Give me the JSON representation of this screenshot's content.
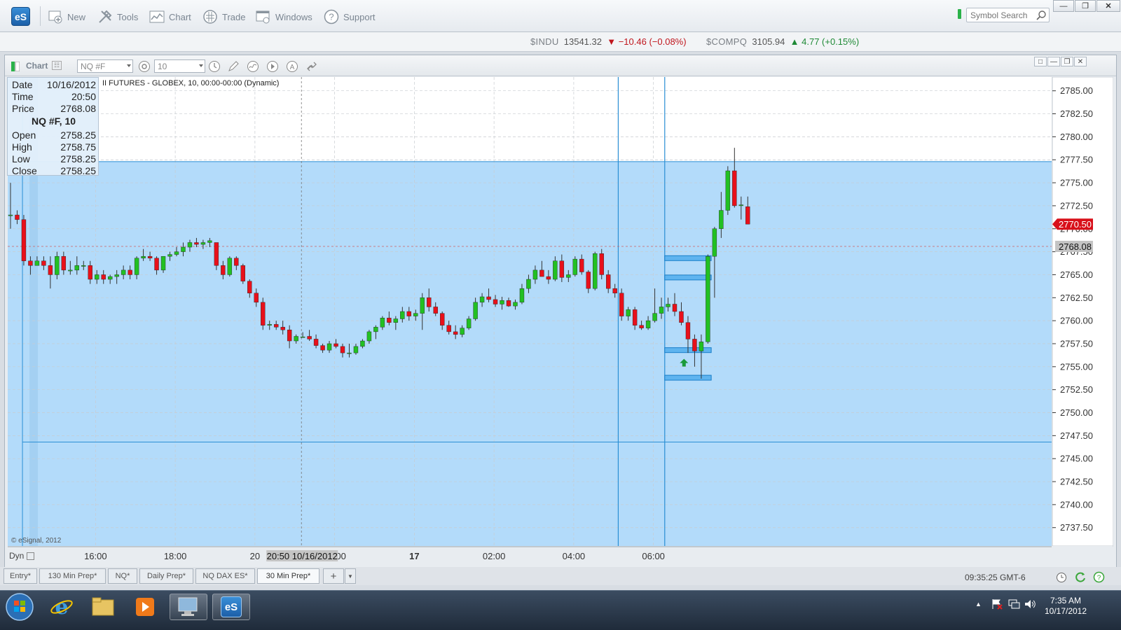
{
  "app": {
    "logo": "eS",
    "toolbar": [
      {
        "label": "New",
        "icon": "new-icon"
      },
      {
        "label": "Tools",
        "icon": "tools-icon"
      },
      {
        "label": "Chart",
        "icon": "chart-icon"
      },
      {
        "label": "Trade",
        "icon": "trade-icon"
      },
      {
        "label": "Windows",
        "icon": "windows-icon"
      },
      {
        "label": "Support",
        "icon": "support-icon"
      }
    ],
    "symbol_search_placeholder": "Symbol Search"
  },
  "tickers": [
    {
      "symbol": "$INDU",
      "value": "13541.32",
      "change": "−10.46 (−0.08%)",
      "direction": "down"
    },
    {
      "symbol": "$COMPQ",
      "value": "3105.94",
      "change": "4.77 (+0.15%)",
      "direction": "up"
    }
  ],
  "chart_window": {
    "title": "Chart",
    "symbol": "NQ #F",
    "interval": "10",
    "description": "II FUTURES - GLOBEX, 10, 00:00-00:00 (Dynamic)",
    "copyright": "© eSignal, 2012",
    "dyn_label": "Dyn"
  },
  "data_window": {
    "date_label": "Date",
    "date": "10/16/2012",
    "time_label": "Time",
    "time": "20:50",
    "price_label": "Price",
    "price": "2768.08",
    "header": "NQ #F, 10",
    "open_label": "Open",
    "open": "2758.25",
    "high_label": "High",
    "high": "2758.75",
    "low_label": "Low",
    "low": "2758.25",
    "close_label": "Close",
    "close": "2758.25"
  },
  "chart_data": {
    "type": "candlestick",
    "y_ticks": [
      "2785.00",
      "2782.50",
      "2780.00",
      "2777.50",
      "2775.00",
      "2772.50",
      "2770.00",
      "2767.50",
      "2765.00",
      "2762.50",
      "2760.00",
      "2757.50",
      "2755.00",
      "2752.50",
      "2750.00",
      "2747.50",
      "2745.00",
      "2742.50",
      "2740.00",
      "2737.50"
    ],
    "ylim": [
      2735.5,
      2786.5
    ],
    "x_ticks": [
      {
        "label": "16:00",
        "bar": 12.8
      },
      {
        "label": "18:00",
        "bar": 24.8
      },
      {
        "label": "20",
        "bar": 36.8
      },
      {
        "label": "22:00",
        "bar": 48.8
      },
      {
        "label": "17",
        "bar": 60.8
      },
      {
        "label": "02:00",
        "bar": 72.8
      },
      {
        "label": "04:00",
        "bar": 84.8
      },
      {
        "label": "06:00",
        "bar": 96.8
      }
    ],
    "crosshair_time_label": "20:50 10/16/2012",
    "last_price": "2770.50",
    "crosshair_price": "2768.08",
    "crosshair_value": 2768.08,
    "crosshair_bar": 43.8,
    "region": {
      "top": 2777.3,
      "bottom": 2746.8,
      "start_bar": 1.8
    },
    "vertical_lines_bars": [
      91.5,
      98.5
    ],
    "level_boxes": [
      2766.8,
      2764.7,
      2756.8,
      2753.8
    ],
    "level_box_range": [
      98.5,
      105.5
    ],
    "arrow": {
      "bar": 101.4,
      "value": 2755.4
    },
    "ohlc": [
      [
        2771.5,
        2775,
        2770,
        2771.5
      ],
      [
        2771.5,
        2772,
        2770.5,
        2771
      ],
      [
        2771,
        2771.5,
        2766,
        2766.5
      ],
      [
        2766.5,
        2767,
        2765,
        2766
      ],
      [
        2766,
        2767,
        2766,
        2766.5
      ],
      [
        2766.5,
        2767,
        2765.5,
        2766
      ],
      [
        2766,
        2767,
        2763.5,
        2765
      ],
      [
        2765,
        2767.5,
        2764.5,
        2767
      ],
      [
        2767,
        2767.5,
        2765,
        2765.5
      ],
      [
        2765.5,
        2766.5,
        2765,
        2765.5
      ],
      [
        2765.5,
        2767,
        2765,
        2766
      ],
      [
        2766,
        2766.5,
        2765.5,
        2766
      ],
      [
        2766,
        2766.5,
        2764,
        2764.5
      ],
      [
        2764.5,
        2765.5,
        2764,
        2765
      ],
      [
        2765,
        2765.5,
        2764,
        2764.5
      ],
      [
        2764.5,
        2765,
        2764,
        2764.8
      ],
      [
        2764.8,
        2765.5,
        2764,
        2765
      ],
      [
        2765,
        2766,
        2764.5,
        2765.5
      ],
      [
        2765.5,
        2766,
        2764.5,
        2765
      ],
      [
        2765,
        2767,
        2764.5,
        2766.8
      ],
      [
        2766.8,
        2767.8,
        2766.5,
        2767
      ],
      [
        2767,
        2767.5,
        2766.5,
        2766.8
      ],
      [
        2766.8,
        2767,
        2765,
        2765.5
      ],
      [
        2765.5,
        2767,
        2765.2,
        2767
      ],
      [
        2767,
        2767.5,
        2766.5,
        2767.2
      ],
      [
        2767.2,
        2768,
        2767,
        2767.5
      ],
      [
        2767.5,
        2768.5,
        2767,
        2768
      ],
      [
        2768,
        2768.8,
        2767.5,
        2768.5
      ],
      [
        2768.5,
        2769,
        2768,
        2768.3
      ],
      [
        2768.3,
        2768.8,
        2767.8,
        2768.5
      ],
      [
        2768.5,
        2769,
        2768,
        2768.7
      ],
      [
        2768.5,
        2768.5,
        2765.5,
        2766
      ],
      [
        2766,
        2766.5,
        2764.5,
        2765
      ],
      [
        2765,
        2767,
        2764.8,
        2766.8
      ],
      [
        2766.8,
        2767,
        2765.5,
        2766
      ],
      [
        2766,
        2766.2,
        2764,
        2764.3
      ],
      [
        2764.3,
        2764.5,
        2762.5,
        2763
      ],
      [
        2763,
        2763.5,
        2761.5,
        2762
      ],
      [
        2762,
        2762.5,
        2759,
        2759.5
      ],
      [
        2759.5,
        2760,
        2759,
        2759.6
      ],
      [
        2759.6,
        2760,
        2759,
        2759.3
      ],
      [
        2759.3,
        2760,
        2758.5,
        2759
      ],
      [
        2759,
        2759.5,
        2757,
        2757.8
      ],
      [
        2757.8,
        2758.5,
        2757.5,
        2758.3
      ],
      [
        2758.25,
        2758.75,
        2758.25,
        2758.25
      ],
      [
        2758.3,
        2759,
        2757.8,
        2758
      ],
      [
        2758,
        2758.5,
        2757,
        2757.3
      ],
      [
        2757.3,
        2757.5,
        2756.5,
        2756.8
      ],
      [
        2756.8,
        2757.8,
        2756.5,
        2757.5
      ],
      [
        2757.5,
        2758,
        2757,
        2757.2
      ],
      [
        2757.2,
        2757.5,
        2756,
        2756.5
      ],
      [
        2756.5,
        2757.5,
        2756,
        2756.5
      ],
      [
        2756.5,
        2757.5,
        2756.3,
        2757.2
      ],
      [
        2757.2,
        2758,
        2757,
        2757.8
      ],
      [
        2757.8,
        2759,
        2757.5,
        2758.8
      ],
      [
        2758.8,
        2759.5,
        2758,
        2759.3
      ],
      [
        2759.3,
        2760.5,
        2759,
        2760.3
      ],
      [
        2760.3,
        2761,
        2759.5,
        2759.8
      ],
      [
        2759.8,
        2760.5,
        2759,
        2760.2
      ],
      [
        2760.2,
        2761.5,
        2759.8,
        2761
      ],
      [
        2761,
        2761.5,
        2760,
        2760.5
      ],
      [
        2760.5,
        2761.2,
        2760,
        2760.8
      ],
      [
        2760.8,
        2763,
        2759,
        2762.5
      ],
      [
        2762.5,
        2763.5,
        2761,
        2761.5
      ],
      [
        2761.5,
        2762,
        2760.5,
        2760.8
      ],
      [
        2760.8,
        2761,
        2759,
        2759.5
      ],
      [
        2759.5,
        2760,
        2758.5,
        2758.8
      ],
      [
        2758.8,
        2759.5,
        2758,
        2758.5
      ],
      [
        2758.5,
        2759.5,
        2758.2,
        2759.2
      ],
      [
        2759.2,
        2760.5,
        2759,
        2760.2
      ],
      [
        2760.2,
        2762.5,
        2760,
        2762
      ],
      [
        2762,
        2763,
        2761.5,
        2762.6
      ],
      [
        2762.6,
        2763.5,
        2762,
        2762.3
      ],
      [
        2762.3,
        2762.8,
        2761.5,
        2761.8
      ],
      [
        2761.8,
        2762.6,
        2761.2,
        2762.2
      ],
      [
        2762.2,
        2762.5,
        2761.5,
        2761.6
      ],
      [
        2761.6,
        2762.3,
        2761.2,
        2762
      ],
      [
        2762,
        2764,
        2761.8,
        2763.5
      ],
      [
        2763.5,
        2765,
        2763,
        2764.5
      ],
      [
        2764.5,
        2766,
        2764,
        2765.5
      ],
      [
        2765.5,
        2766.5,
        2765,
        2764.8
      ],
      [
        2764.8,
        2765.5,
        2764,
        2764.5
      ],
      [
        2764.5,
        2767,
        2764.3,
        2766.5
      ],
      [
        2766.5,
        2767.2,
        2764.2,
        2764.7
      ],
      [
        2764.7,
        2765.5,
        2764.2,
        2765
      ],
      [
        2765,
        2767,
        2764.8,
        2766.7
      ],
      [
        2766.7,
        2767.2,
        2765,
        2765.3
      ],
      [
        2765.3,
        2765.5,
        2763,
        2763.5
      ],
      [
        2763.5,
        2767.5,
        2763.3,
        2767.3
      ],
      [
        2767.3,
        2767.8,
        2764.5,
        2765
      ],
      [
        2765,
        2765.5,
        2763,
        2763.5
      ],
      [
        2763.5,
        2764,
        2762.5,
        2763
      ],
      [
        2763,
        2763.5,
        2760,
        2760.5
      ],
      [
        2760.5,
        2761.5,
        2760,
        2761.2
      ],
      [
        2761.2,
        2761.5,
        2759,
        2759.5
      ],
      [
        2759.5,
        2760,
        2759,
        2759.2
      ],
      [
        2759.2,
        2760.5,
        2759,
        2760
      ],
      [
        2760,
        2763.5,
        2759.8,
        2760.8
      ],
      [
        2760.8,
        2762.5,
        2760.2,
        2761.5
      ],
      [
        2761.5,
        2762.5,
        2761,
        2761.8
      ],
      [
        2761.8,
        2763,
        2760.5,
        2761
      ],
      [
        2761,
        2762,
        2759.5,
        2759.8
      ],
      [
        2759.8,
        2760.5,
        2756.5,
        2758
      ],
      [
        2758,
        2758.5,
        2755,
        2756.7
      ],
      [
        2756.7,
        2758.5,
        2753.7,
        2757.7
      ],
      [
        2757.7,
        2767.2,
        2757.5,
        2767
      ],
      [
        2767,
        2770.2,
        2762.5,
        2770
      ],
      [
        2770,
        2774,
        2769,
        2772
      ],
      [
        2772,
        2776.8,
        2771.5,
        2776.3
      ],
      [
        2776.3,
        2778.8,
        2772.3,
        2772.5
      ],
      [
        2772.5,
        2773.5,
        2771,
        2772.6
      ],
      [
        2772.4,
        2773.5,
        2770.5,
        2770.5
      ]
    ]
  },
  "tabs": [
    "Entry*",
    "130 Min Prep*",
    "NQ*",
    "Daily Prep*",
    "NQ DAX ES*",
    "30 Min Prep*"
  ],
  "active_tab": "30 Min Prep*",
  "status_time": "09:35:25 GMT-6",
  "taskbar": {
    "time": "7:35 AM",
    "date": "10/17/2012"
  },
  "colors": {
    "up": "#22c022",
    "down": "#e8101a",
    "region": "#b3dbfa",
    "line": "#2a8fd4"
  }
}
